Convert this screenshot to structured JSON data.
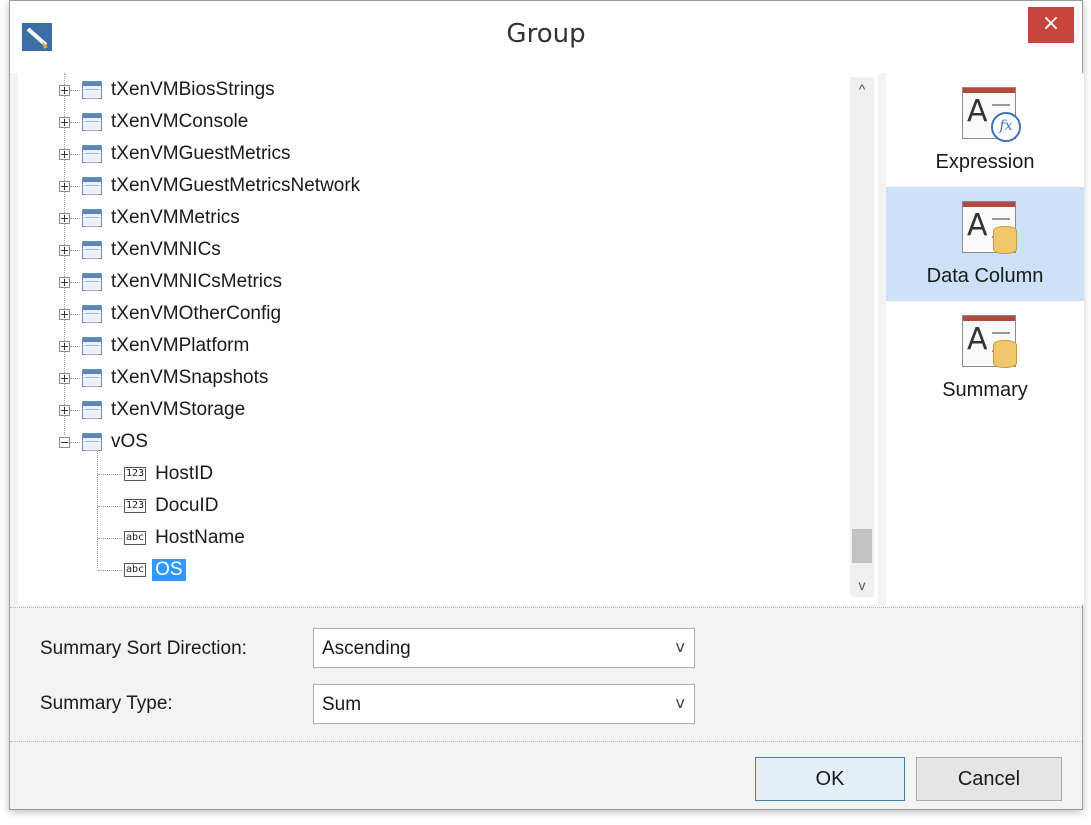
{
  "window": {
    "title": "Group",
    "close_glyph": "×"
  },
  "tree": {
    "tables": [
      "tXenVMBiosStrings",
      "tXenVMConsole",
      "tXenVMGuestMetrics",
      "tXenVMGuestMetricsNetwork",
      "tXenVMMetrics",
      "tXenVMNICs",
      "tXenVMNICsMetrics",
      "tXenVMOtherConfig",
      "tXenVMPlatform",
      "tXenVMSnapshots",
      "tXenVMStorage"
    ],
    "expanded_table": "vOS",
    "columns": [
      {
        "type_badge": "123",
        "name": "HostID"
      },
      {
        "type_badge": "123",
        "name": "DocuID"
      },
      {
        "type_badge": "abc",
        "name": "HostName"
      },
      {
        "type_badge": "abc",
        "name": "OS"
      }
    ],
    "selected": "OS",
    "scroll_up_glyph": "^",
    "scroll_down_glyph": "v"
  },
  "side_panel": {
    "items": [
      {
        "label": "Expression",
        "icon": "expression-icon",
        "active": false
      },
      {
        "label": "Data Column",
        "icon": "data-column-icon",
        "active": true
      },
      {
        "label": "Summary",
        "icon": "summary-icon",
        "active": false
      }
    ]
  },
  "form": {
    "sort_direction": {
      "label": "Summary Sort Direction:",
      "value": "Ascending"
    },
    "summary_type": {
      "label": "Summary Type:",
      "value": "Sum"
    },
    "chevron": "v"
  },
  "buttons": {
    "ok": "OK",
    "cancel": "Cancel"
  },
  "colors": {
    "selection": "#3399ff",
    "active_side": "#cce0f7",
    "close": "#c7453c"
  }
}
